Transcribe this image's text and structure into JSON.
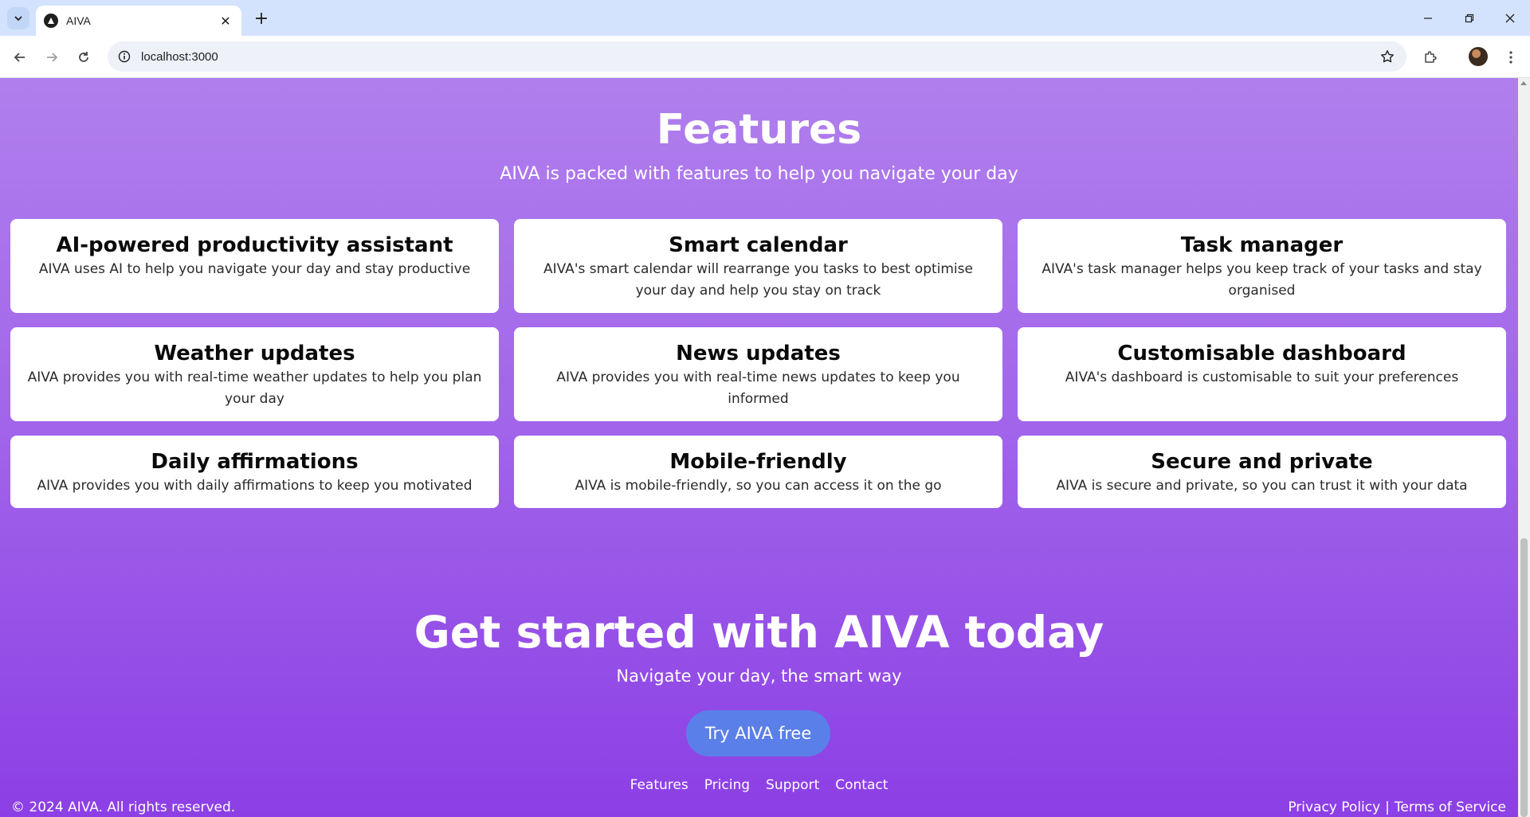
{
  "browser": {
    "tab_title": "AIVA",
    "url": "localhost:3000",
    "new_tab_symbol": "+",
    "close_symbol": "✕"
  },
  "features": {
    "title": "Features",
    "subtitle": "AIVA is packed with features to help you navigate your day",
    "cards": [
      {
        "title": "AI-powered productivity assistant",
        "desc": "AIVA uses AI to help you navigate your day and stay productive"
      },
      {
        "title": "Smart calendar",
        "desc": "AIVA's smart calendar will rearrange you tasks to best optimise your day and help you stay on track"
      },
      {
        "title": "Task manager",
        "desc": "AIVA's task manager helps you keep track of your tasks and stay organised"
      },
      {
        "title": "Weather updates",
        "desc": "AIVA provides you with real-time weather updates to help you plan your day"
      },
      {
        "title": "News updates",
        "desc": "AIVA provides you with real-time news updates to keep you informed"
      },
      {
        "title": "Customisable dashboard",
        "desc": "AIVA's dashboard is customisable to suit your preferences"
      },
      {
        "title": "Daily affirmations",
        "desc": "AIVA provides you with daily affirmations to keep you motivated"
      },
      {
        "title": "Mobile-friendly",
        "desc": "AIVA is mobile-friendly, so you can access it on the go"
      },
      {
        "title": "Secure and private",
        "desc": "AIVA is secure and private, so you can trust it with your data"
      }
    ]
  },
  "cta": {
    "title": "Get started with AIVA today",
    "subtitle": "Navigate your day, the smart way",
    "button": "Try AIVA free"
  },
  "footer": {
    "links": [
      "Features",
      "Pricing",
      "Support",
      "Contact"
    ],
    "copyright": "© 2024 AIVA. All rights reserved.",
    "privacy": "Privacy Policy",
    "separator": "|",
    "terms": "Terms of Service"
  },
  "colors": {
    "gradient_top": "#b07fed",
    "gradient_bottom": "#8c3fe5",
    "button": "#5b7fe9",
    "tabstrip": "#d3e3fd"
  }
}
